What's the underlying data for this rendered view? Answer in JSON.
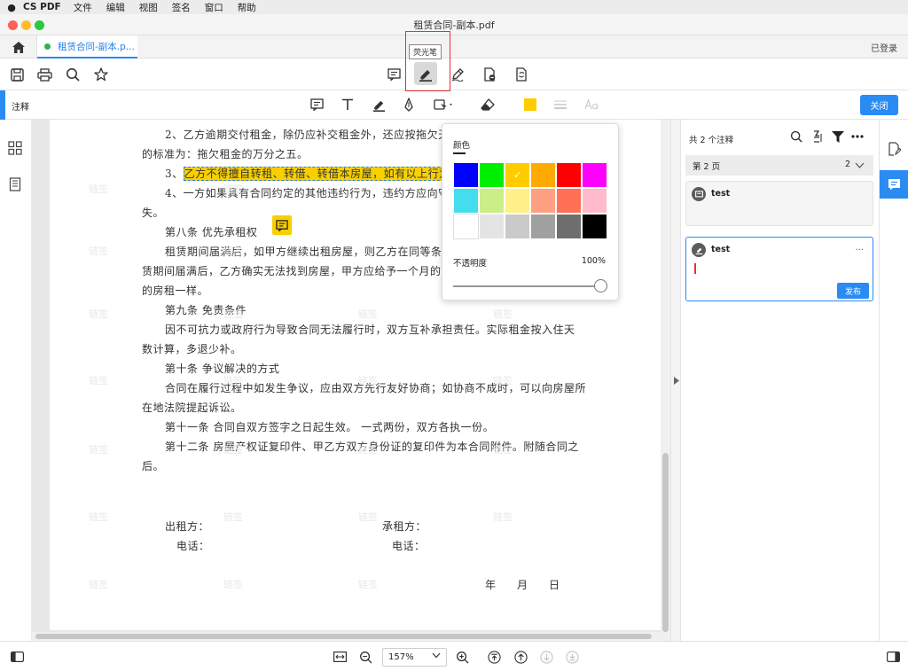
{
  "menubar": {
    "app": "CS PDF",
    "items": [
      "文件",
      "编辑",
      "视图",
      "签名",
      "窗口",
      "帮助"
    ]
  },
  "window": {
    "title": "租赁合同-副本.pdf"
  },
  "tabs": {
    "active_label": "租赁合同-副本.p...",
    "login": "已登录"
  },
  "toolbar": {
    "tooltip": "荧光笔"
  },
  "annotation_bar": {
    "label": "注释",
    "close_label": "关闭"
  },
  "document": {
    "lines": [
      "2、乙方逾期交付租金，除仍应补交租金外，还应按拖欠天数",
      "的标准为：拖欠租金的万分之五。",
      "3、",
      "乙方不得擅自转租、转借、转借本房屋，如有以上行为的",
      "4、一方如果具有合同约定的其他违约行为，违约方应向守约",
      "失。",
      "第八条  优先承租权",
      "租赁期间届满后，如甲方继续出租房屋，则乙方在同等条件",
      "赁期间届满后，乙方确实无法找到房屋，甲方应给予一个月的宽限",
      "的房租一样。",
      "第九条  免责条件",
      "因不可抗力或政府行为导致合同无法履行时，双方互补承担责任。实际租金按入住天",
      "数计算，多退少补。",
      "第十条  争议解决的方式",
      "合同在履行过程中如发生争议，应由双方先行友好协商；如协商不成时，可以向房屋所",
      "在地法院提起诉讼。",
      "第十一条  合同自双方签字之日起生效。  一式两份，双方各执一份。",
      "第十二条  房屋产权证复印件、甲乙方双方身份证的复印件为本合同附件。附随合同之",
      "后。",
      "出租方：",
      "承租方：",
      "电话：",
      "电话：",
      "年",
      "月",
      "日"
    ],
    "watermark": "链签"
  },
  "color_popover": {
    "title": "颜色",
    "colors": [
      "#0000ff",
      "#00ee00",
      "#ffcc00",
      "#ffaa00",
      "#ff0000",
      "#ff00ff",
      "#44ddee",
      "#ccee88",
      "#fff08a",
      "#ffa082",
      "#ff7055",
      "#ffbbcc",
      "#ffffff",
      "#e4e4e4",
      "#cacaca",
      "#a0a0a0",
      "#6e6e6e",
      "#000000"
    ],
    "selected_index": 2,
    "check": "✓",
    "opacity_label": "不透明度",
    "opacity_value": "100%",
    "opacity_level": 1.0
  },
  "right_panel": {
    "count_label": "共 2 个注释",
    "page_group": {
      "label": "第 2 页",
      "count": "2"
    },
    "cards": [
      {
        "author": "test"
      },
      {
        "author": "test",
        "more": "...",
        "publish_label": "发布"
      }
    ]
  },
  "statusbar": {
    "zoom": "157%"
  },
  "colors": {
    "accent": "#2a8bf2",
    "highlight": "#f8d000"
  }
}
